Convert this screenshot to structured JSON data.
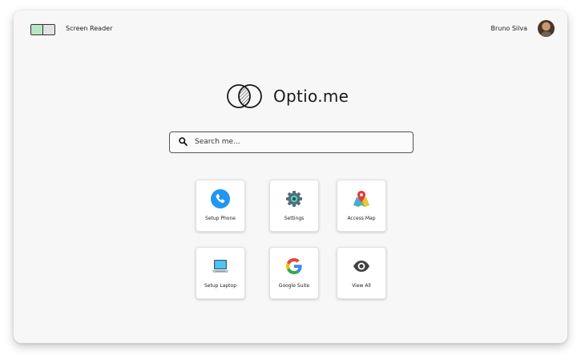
{
  "header": {
    "screen_reader_label": "Screen Reader",
    "user_name": "Bruno Silva"
  },
  "brand": {
    "name": "Optio.me"
  },
  "search": {
    "placeholder": "Search me..."
  },
  "tiles": [
    {
      "label": "Setup Phone",
      "icon": "phone-icon",
      "color": "#2196f3"
    },
    {
      "label": "Settings",
      "icon": "gear-icon",
      "color": "#546e7a"
    },
    {
      "label": "Access Map",
      "icon": "map-pin-icon",
      "color": "#e53935"
    },
    {
      "label": "Setup Laptop",
      "icon": "laptop-icon",
      "color": "#4fc3f7"
    },
    {
      "label": "Google Suite",
      "icon": "google-icon",
      "color": "#4285f4"
    },
    {
      "label": "View All",
      "icon": "eye-icon",
      "color": "#424242"
    }
  ]
}
